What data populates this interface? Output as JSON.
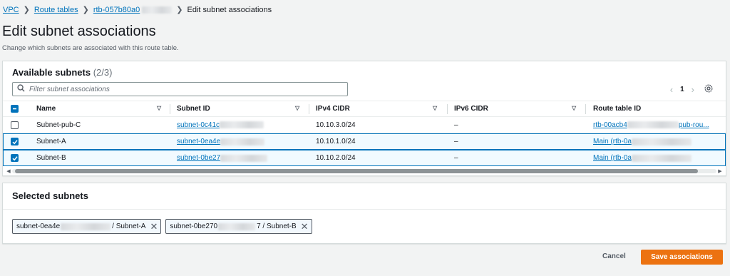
{
  "breadcrumb": {
    "vpc": "VPC",
    "route_tables": "Route tables",
    "rtb": "rtb-057b80a0",
    "current": "Edit subnet associations"
  },
  "page": {
    "title": "Edit subnet associations",
    "description": "Change which subnets are associated with this route table."
  },
  "available": {
    "title": "Available subnets",
    "count": "(2/3)",
    "search_placeholder": "Filter subnet associations",
    "page_number": "1",
    "columns": [
      "Name",
      "Subnet ID",
      "IPv4 CIDR",
      "IPv6 CIDR",
      "Route table ID"
    ],
    "rows": [
      {
        "name": "Subnet-pub-C",
        "subnet_id": "subnet-0c41c",
        "ipv4": "10.10.3.0/24",
        "ipv6": "–",
        "route_table": "rtb-00acb4",
        "route_table_suffix": "pub-rou...",
        "checked": false
      },
      {
        "name": "Subnet-A",
        "subnet_id": "subnet-0ea4e",
        "ipv4": "10.10.1.0/24",
        "ipv6": "–",
        "route_table": "Main (rtb-0a",
        "route_table_suffix": "",
        "checked": true
      },
      {
        "name": "Subnet-B",
        "subnet_id": "subnet-0be27",
        "ipv4": "10.10.2.0/24",
        "ipv6": "–",
        "route_table": "Main (rtb-0a",
        "route_table_suffix": "",
        "checked": true
      }
    ]
  },
  "selected": {
    "title": "Selected subnets",
    "tokens": [
      {
        "id": "subnet-0ea4e",
        "suffix": "/ Subnet-A"
      },
      {
        "id": "subnet-0be270",
        "suffix": "7 / Subnet-B"
      }
    ]
  },
  "actions": {
    "cancel": "Cancel",
    "save": "Save associations"
  },
  "colors": {
    "link": "#0073bb",
    "primary_button": "#ec7211",
    "selected_row_bg": "#f1faff"
  }
}
